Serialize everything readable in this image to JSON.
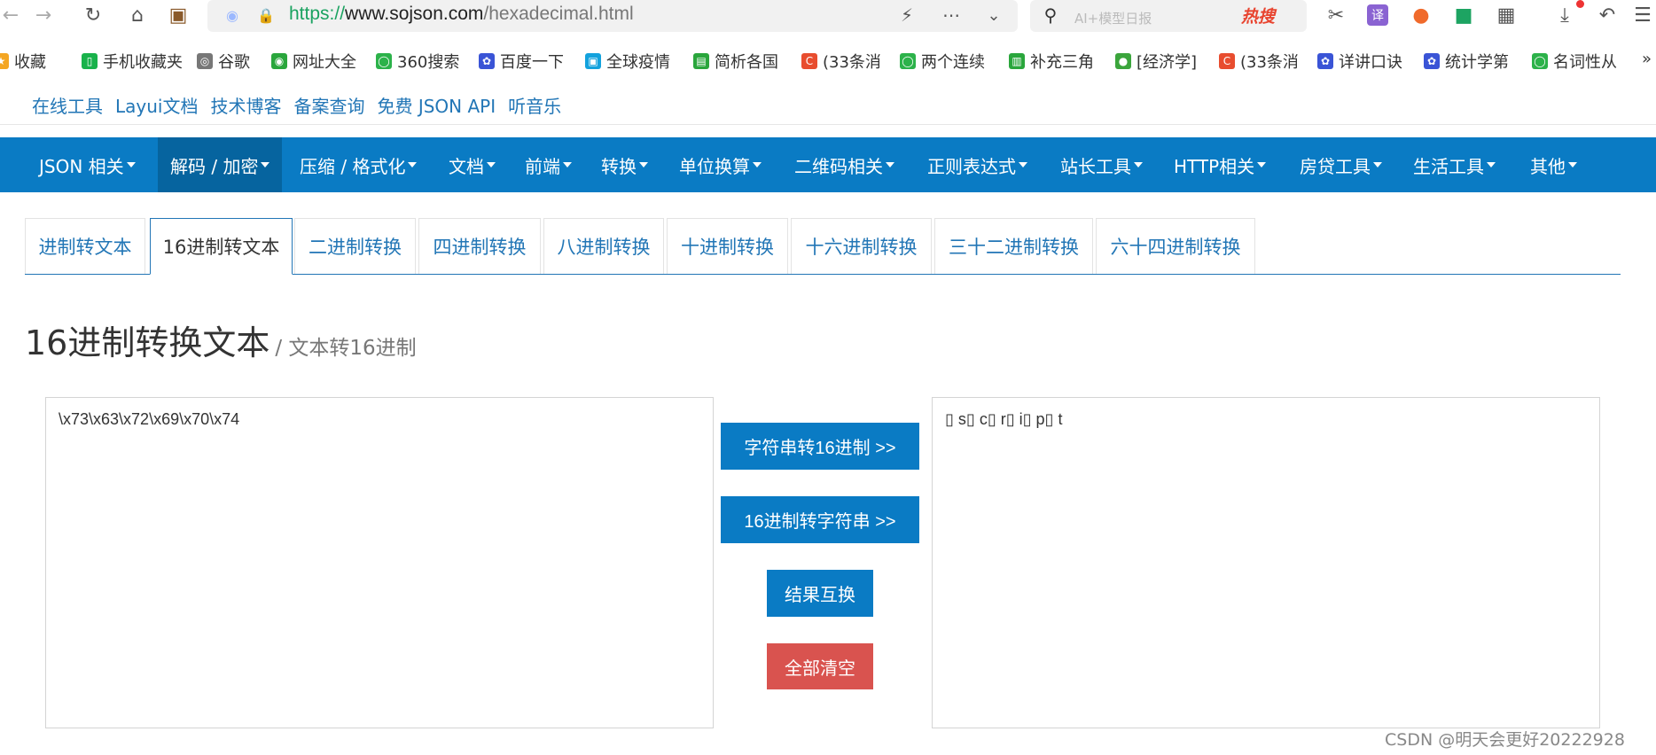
{
  "browser": {
    "url_scheme": "https://",
    "url_host": "www.sojson.com",
    "url_path": "/hexadecimal.html",
    "search_placeholder": "AI+模型日报",
    "hot_label": "热搜"
  },
  "bookmarks": [
    {
      "label": "收藏",
      "icon": "star-icon",
      "color": "#f4a623"
    },
    {
      "label": "手机收藏夹",
      "icon": "phone-icon",
      "color": "#19b24b"
    },
    {
      "label": "谷歌",
      "icon": "globe-icon",
      "color": "#777777"
    },
    {
      "label": "网址大全",
      "icon": "site-icon",
      "color": "#2aa63c"
    },
    {
      "label": "360搜索",
      "icon": "search360-icon",
      "color": "#2cb24a"
    },
    {
      "label": "百度一下",
      "icon": "baidu-paw-icon",
      "color": "#3a54d6"
    },
    {
      "label": "全球疫情",
      "icon": "bili-icon",
      "color": "#13a2dd"
    },
    {
      "label": "简析各国",
      "icon": "book-icon",
      "color": "#2aa63c"
    },
    {
      "label": "(33条消",
      "icon": "csdn-icon",
      "color": "#e84d2f"
    },
    {
      "label": "两个连续",
      "icon": "search360-icon",
      "color": "#2cb24a"
    },
    {
      "label": "补充三角",
      "icon": "doc-icon",
      "color": "#2aa63c"
    },
    {
      "label": "[经济学]",
      "icon": "leaf-icon",
      "color": "#3ba53c"
    },
    {
      "label": "(33条消",
      "icon": "csdn-icon",
      "color": "#e84d2f"
    },
    {
      "label": "详讲口诀",
      "icon": "baidu-paw-icon",
      "color": "#3a54d6"
    },
    {
      "label": "统计学第",
      "icon": "baidu-paw-icon",
      "color": "#3a54d6"
    },
    {
      "label": "名词性从",
      "icon": "search360-icon",
      "color": "#2cb24a"
    }
  ],
  "toplinks": [
    "在线工具",
    "Layui文档",
    "技术博客",
    "备案查询",
    "免费 JSON API",
    "听音乐"
  ],
  "nav": [
    "JSON 相关",
    "解码 / 加密",
    "压缩 / 格式化",
    "文档",
    "前端",
    "转换",
    "单位换算",
    "二维码相关",
    "正则表达式",
    "站长工具",
    "HTTP相关",
    "房贷工具",
    "生活工具",
    "其他"
  ],
  "tabs": [
    "进制转文本",
    "16进制转文本",
    "二进制转换",
    "四进制转换",
    "八进制转换",
    "十进制转换",
    "十六进制转换",
    "三十二进制转换",
    "六十四进制转换"
  ],
  "page": {
    "title": "16进制转换文本",
    "subtitle": "/ 文本转16进制",
    "input_value": "\\x73\\x63\\x72\\x69\\x70\\x74",
    "output_value": "▯ s▯ c▯ r▯ i▯ p▯ t"
  },
  "buttons": {
    "str_to_hex": "字符串转16进制 >>",
    "hex_to_str": "16进制转字符串 >>",
    "swap": "结果互换",
    "clear": "全部清空"
  },
  "watermark": "CSDN @明天会更好20222928",
  "colors": {
    "nav_bg": "#0a7bc4",
    "nav_active": "#06649f",
    "link": "#2276b6",
    "clear_button": "#d9534f"
  }
}
